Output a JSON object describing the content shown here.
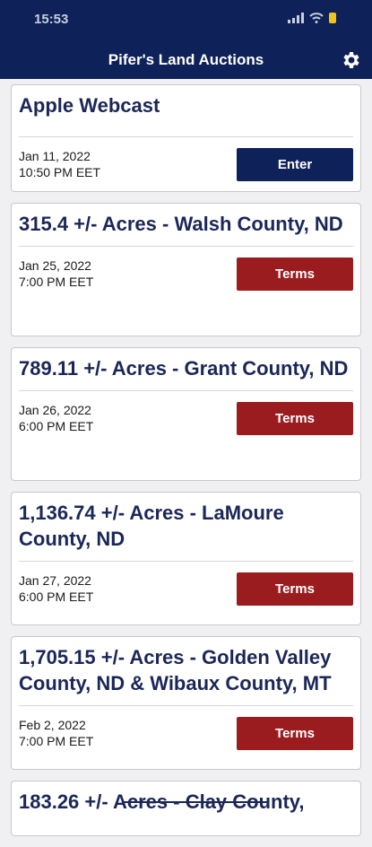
{
  "status_bar": {
    "time": "15:53"
  },
  "header": {
    "title": "Pifer's Land Auctions",
    "settings_icon": "gear-icon"
  },
  "auctions": [
    {
      "title": "Apple Webcast",
      "date": "Jan 11, 2022",
      "time": "10:50 PM EET",
      "button": "Enter",
      "button_color": "#0e2158"
    },
    {
      "title": "315.4 +/- Acres - Walsh County, ND",
      "date": "Jan 25, 2022",
      "time": "7:00 PM EET",
      "button": "Terms",
      "button_color": "#9b1c1f"
    },
    {
      "title": "789.11 +/- Acres - Grant County, ND",
      "date": "Jan 26, 2022",
      "time": "6:00 PM EET",
      "button": "Terms",
      "button_color": "#9b1c1f"
    },
    {
      "title": "1,136.74 +/- Acres - LaMoure County, ND",
      "date": "Jan 27, 2022",
      "time": "6:00 PM EET",
      "button": "Terms",
      "button_color": "#9b1c1f"
    },
    {
      "title": "1,705.15 +/- Acres - Golden Valley County, ND & Wibaux County, MT",
      "date": "Feb 2, 2022",
      "time": "7:00 PM EET",
      "button": "Terms",
      "button_color": "#9b1c1f"
    },
    {
      "title": "183.26 +/- Acres - Clay County,"
    }
  ],
  "colors": {
    "header_bg": "#0e2158",
    "title_text": "#1b2757",
    "terms_button": "#9b1c1f",
    "enter_button": "#0e2158"
  }
}
